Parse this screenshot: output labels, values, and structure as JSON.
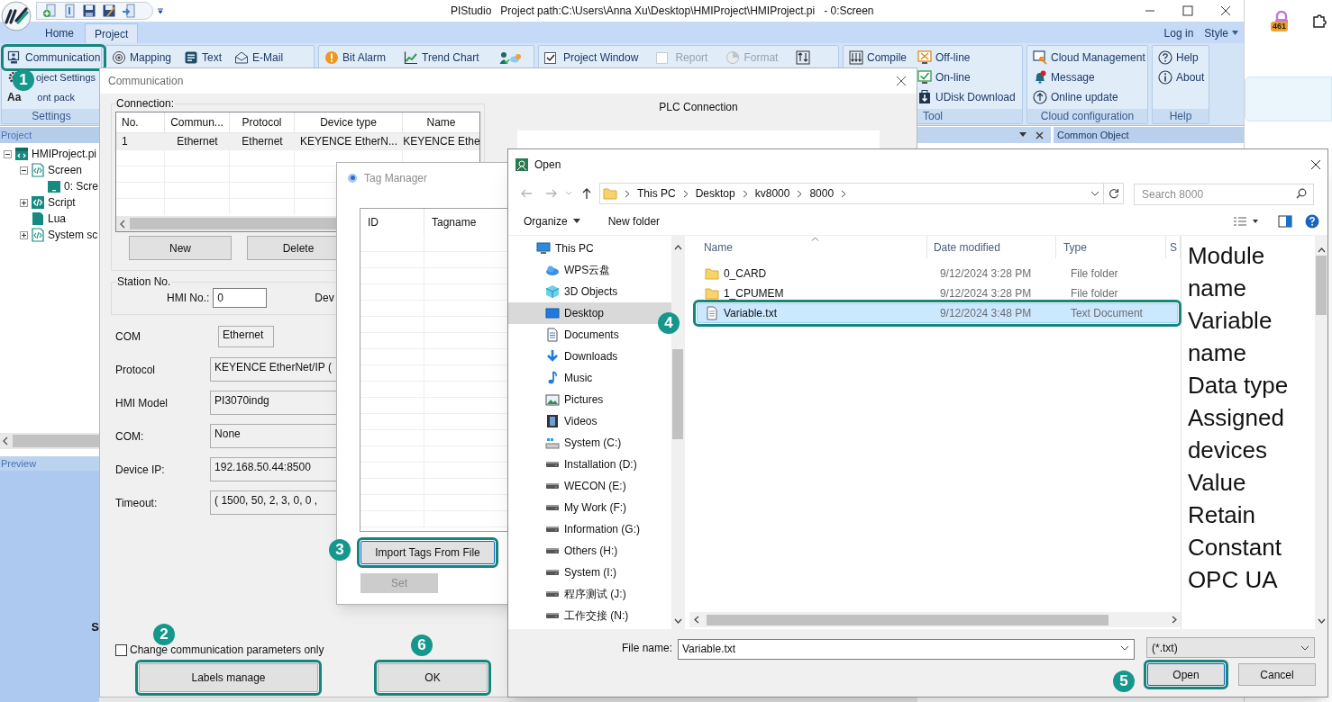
{
  "app": {
    "title": "PIStudio   Project path:C:\\Users\\Anna Xu\\Desktop\\HMIProject\\HMIProject.pi   - 0:Screen",
    "tabs": [
      {
        "label": "Home",
        "selected": false
      },
      {
        "label": "Project",
        "selected": true
      }
    ],
    "account_links": [
      "Log in",
      "Style"
    ]
  },
  "ribbon": {
    "groups": [
      {
        "label": "Settings",
        "columns": [
          [
            {
              "kind": "button",
              "label": "Communication",
              "step": "1"
            },
            {
              "kind": "button",
              "label": "oject Settings"
            },
            {
              "kind": "button",
              "label": "ont pack",
              "glyph": "Aa"
            }
          ]
        ]
      },
      {
        "columns": [
          [
            {
              "kind": "button",
              "label": "Mapping"
            }
          ],
          [
            {
              "kind": "button",
              "label": "Text"
            }
          ],
          [
            {
              "kind": "button",
              "label": "E-Mail"
            }
          ]
        ]
      },
      {
        "columns": [
          [
            {
              "kind": "button",
              "label": "Bit Alarm"
            }
          ],
          [
            {
              "kind": "button",
              "label": "Trend Chart"
            }
          ],
          [
            {
              "kind": "icon"
            }
          ]
        ]
      },
      {
        "columns": [
          [
            {
              "kind": "checkbox",
              "label": "Project Window",
              "checked": true,
              "disabled": false
            }
          ],
          [
            {
              "kind": "checkbox",
              "label": "Report",
              "checked": false,
              "disabled": true
            }
          ],
          [
            {
              "kind": "button",
              "label": "Format",
              "disabled": true
            }
          ],
          [
            {
              "kind": "icon"
            }
          ]
        ]
      },
      {
        "label": "Tool",
        "columns": [
          [
            {
              "kind": "button",
              "label": "Compile"
            }
          ],
          [
            {
              "kind": "button",
              "label": "Off-line"
            },
            {
              "kind": "button",
              "label": "On-line"
            },
            {
              "kind": "button",
              "label": "UDisk Download"
            }
          ]
        ]
      },
      {
        "label": "Cloud configuration",
        "columns": [
          [
            {
              "kind": "button",
              "label": "Cloud Management"
            },
            {
              "kind": "button",
              "label": "Message"
            },
            {
              "kind": "button",
              "label": "Online update"
            }
          ]
        ]
      },
      {
        "label": "Help",
        "columns": [
          [
            {
              "kind": "button",
              "label": "Help"
            },
            {
              "kind": "button",
              "label": "About"
            }
          ]
        ]
      }
    ]
  },
  "project_panel": {
    "title": "Project",
    "tree": [
      {
        "label": "HMIProject.pi",
        "kind": "project",
        "expanded": true,
        "children": [
          {
            "label": "Screen",
            "kind": "screens",
            "expanded": true,
            "children": [
              {
                "label": "0: Scre",
                "kind": "screen"
              }
            ]
          },
          {
            "label": "Script",
            "kind": "scripts",
            "expanded": false
          },
          {
            "label": "Lua",
            "kind": "lua"
          },
          {
            "label": "System sc",
            "kind": "system",
            "expanded": false
          }
        ]
      }
    ],
    "preview_title": "Preview",
    "stray_text": "S"
  },
  "common_panel": {
    "title": "Common Object"
  },
  "browser": {
    "extension_badge": "461"
  },
  "communication_dialog": {
    "title": "Communication",
    "connection": {
      "label": "Connection:",
      "columns": [
        "No.",
        "Commun...",
        "Protocol",
        "Device type",
        "Name"
      ],
      "rows": [
        [
          "1",
          "Ethernet",
          "Ethernet",
          "KEYENCE EtherN...",
          "KEYENCE Ethe"
        ]
      ],
      "buttons": [
        "New",
        "Delete"
      ]
    },
    "plc_label": "PLC Connection",
    "station": {
      "label": "Station No.",
      "hmi_label": "HMI No.:",
      "hmi_value": "0",
      "device_label": "Dev"
    },
    "fields": [
      {
        "label": "COM",
        "value": "Ethernet",
        "kind": "short"
      },
      {
        "label": "Protocol",
        "value": "KEYENCE EtherNet/IP (",
        "kind": "wide"
      },
      {
        "label": "HMI Model",
        "value": "PI3070indg",
        "kind": "wide"
      },
      {
        "label": "COM:",
        "value": "None",
        "kind": "wide"
      },
      {
        "label": "Device IP:",
        "value": "192.168.50.44:8500",
        "kind": "wide"
      },
      {
        "label": "Timeout:",
        "value": "( 1500, 50, 2, 3, 0, 0 ,",
        "kind": "wide"
      }
    ],
    "checkbox": {
      "label": "Change communication parameters only",
      "checked": false
    },
    "buttons": [
      {
        "label": "Labels manage",
        "step": "2"
      },
      {
        "label": "OK",
        "step": "6"
      }
    ]
  },
  "tag_manager": {
    "title": "Tag Manager",
    "columns": [
      "ID",
      "Tagname"
    ],
    "buttons": [
      {
        "label": "Import Tags From File",
        "step": "3",
        "disabled": false
      },
      {
        "label": "Set",
        "disabled": true
      }
    ]
  },
  "open_dialog": {
    "title": "Open",
    "breadcrumb": [
      "This PC",
      "Desktop",
      "kv8000",
      "8000"
    ],
    "search_placeholder": "Search 8000",
    "toolbar": [
      "Organize",
      "New folder"
    ],
    "nav": [
      {
        "label": "This PC",
        "kind": "pc",
        "selected": false
      },
      {
        "label": "WPS云盘",
        "kind": "cloud",
        "selected": false
      },
      {
        "label": "3D Objects",
        "kind": "objects",
        "selected": false
      },
      {
        "label": "Desktop",
        "kind": "desktop",
        "selected": true
      },
      {
        "label": "Documents",
        "kind": "documents",
        "selected": false
      },
      {
        "label": "Downloads",
        "kind": "downloads",
        "selected": false
      },
      {
        "label": "Music",
        "kind": "music",
        "selected": false
      },
      {
        "label": "Pictures",
        "kind": "pictures",
        "selected": false
      },
      {
        "label": "Videos",
        "kind": "videos",
        "selected": false
      },
      {
        "label": "System (C:)",
        "kind": "system-drive",
        "selected": false
      },
      {
        "label": "Installation (D:)",
        "kind": "drive",
        "selected": false
      },
      {
        "label": "WECON  (E:)",
        "kind": "drive",
        "selected": false
      },
      {
        "label": "My Work (F:)",
        "kind": "drive",
        "selected": false
      },
      {
        "label": "Information (G:)",
        "kind": "drive",
        "selected": false
      },
      {
        "label": "Others (H:)",
        "kind": "drive",
        "selected": false
      },
      {
        "label": "System (I:)",
        "kind": "drive",
        "selected": false
      },
      {
        "label": "程序测试 (J:)",
        "kind": "drive",
        "selected": false
      },
      {
        "label": "工作交接 (N:)",
        "kind": "drive",
        "selected": false
      }
    ],
    "columns": [
      "Name",
      "Date modified",
      "Type",
      "S"
    ],
    "files": [
      {
        "name": "0_CARD",
        "date": "9/12/2024 3:28 PM",
        "type": "File folder",
        "kind": "folder",
        "selected": false
      },
      {
        "name": "1_CPUMEM",
        "date": "9/12/2024 3:28 PM",
        "type": "File folder",
        "kind": "folder",
        "selected": false
      },
      {
        "name": "Variable.txt",
        "date": "9/12/2024 3:48 PM",
        "type": "Text Document",
        "kind": "document",
        "selected": true,
        "step": "4"
      }
    ],
    "preview": "Module name\tVariable name\tData type\tAssigned devices\tValue\tRetain\tConstant\tOPC UA",
    "file_name_label": "File name:",
    "file_name": "Variable.txt",
    "filter": "(*.txt)",
    "buttons": [
      {
        "label": "Open",
        "step": "5"
      },
      {
        "label": "Cancel"
      }
    ]
  }
}
